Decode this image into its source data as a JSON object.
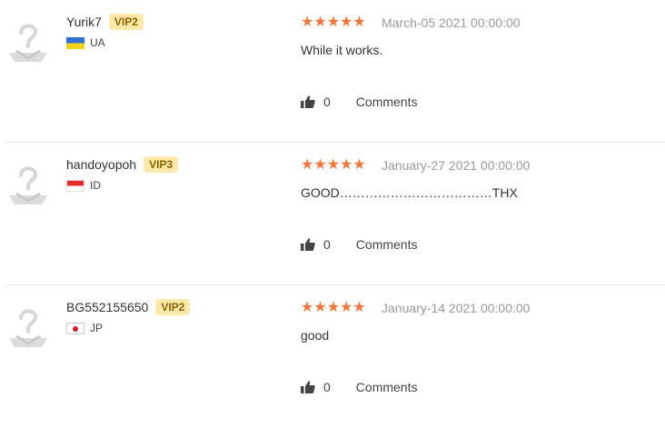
{
  "reviews": [
    {
      "username": "Yurik7",
      "vip": "VIP2",
      "country": "UA",
      "stars": "★★★★★",
      "date": "March-05 2021 00:00:00",
      "text": "While it works.",
      "likes": "0",
      "comments_label": "Comments"
    },
    {
      "username": "handoyopoh",
      "vip": "VIP3",
      "country": "ID",
      "stars": "★★★★★",
      "date": "January-27 2021 00:00:00",
      "text": "GOOD………………………………THX",
      "likes": "0",
      "comments_label": "Comments"
    },
    {
      "username": "BG552155650",
      "vip": "VIP2",
      "country": "JP",
      "stars": "★★★★★",
      "date": "January-14 2021 00:00:00",
      "text": "good",
      "likes": "0",
      "comments_label": "Comments"
    }
  ],
  "colors": {
    "star": "#f2763a",
    "vip_bg": "#fce8a8",
    "date": "#9a9a9a"
  },
  "icons": [
    "avatar-placeholder-icon",
    "thumbs-up-icon"
  ]
}
